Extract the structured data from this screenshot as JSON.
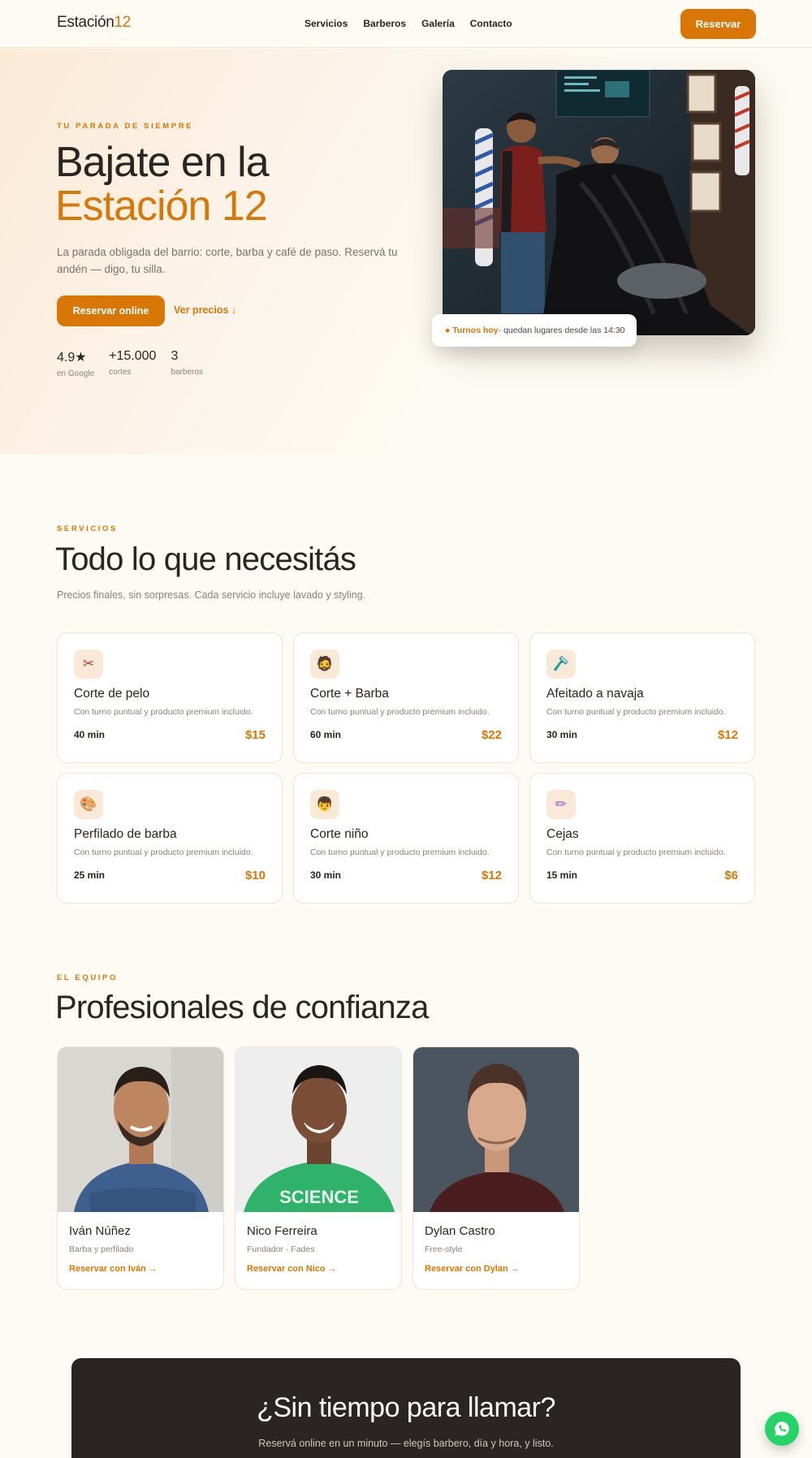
{
  "brand": {
    "name_main": "Estación",
    "name_num": "12"
  },
  "nav": {
    "links": [
      "Servicios",
      "Barberos",
      "Galería",
      "Contacto"
    ],
    "cta": "Reservar"
  },
  "hero": {
    "eyebrow": "TU PARADA DE SIEMPRE",
    "title_line1": "Bajate en la",
    "title_line2": "Estación 12",
    "description": "La parada obligada del barrio: corte, barba y café de paso. Reservá tu andén — digo, tu silla.",
    "primary_cta": "Reservar online",
    "secondary_cta": "Ver precios ↓",
    "stats": [
      {
        "value": "4.9★",
        "label": "en Google"
      },
      {
        "value": "+15.000",
        "label": "cortes"
      },
      {
        "value": "3",
        "label": "barberos"
      }
    ],
    "turnos_highlight": "● Turnos hoy",
    "turnos_text": " · quedan lugares desde las 14:30"
  },
  "services": {
    "eyebrow": "SERVICIOS",
    "title": "Todo lo que necesitás",
    "subtitle": "Precios finales, sin sorpresas. Cada servicio incluye lavado y styling.",
    "items": [
      {
        "icon": "scissors-icon",
        "glyph": "✂",
        "name": "Corte de pelo",
        "desc": "Con turno puntual y producto premium incluido.",
        "duration": "40 min",
        "price": "$15"
      },
      {
        "icon": "bearded-face-icon",
        "glyph": "🧔",
        "name": "Corte + Barba",
        "desc": "Con turno puntual y producto premium incluido.",
        "duration": "60 min",
        "price": "$22"
      },
      {
        "icon": "razor-icon",
        "glyph": "🪒",
        "name": "Afeitado a navaja",
        "desc": "Con turno puntual y producto premium incluido.",
        "duration": "30 min",
        "price": "$12"
      },
      {
        "icon": "palette-icon",
        "glyph": "🎨",
        "name": "Perfilado de barba",
        "desc": "Con turno puntual y producto premium incluido.",
        "duration": "25 min",
        "price": "$10"
      },
      {
        "icon": "child-icon",
        "glyph": "👦",
        "name": "Corte niño",
        "desc": "Con turno puntual y producto premium incluido.",
        "duration": "30 min",
        "price": "$12"
      },
      {
        "icon": "brow-pencil-icon",
        "glyph": "✏",
        "name": "Cejas",
        "desc": "Con turno puntual y producto premium incluido.",
        "duration": "15 min",
        "price": "$6"
      }
    ]
  },
  "team": {
    "eyebrow": "EL EQUIPO",
    "title": "Profesionales de confianza",
    "members": [
      {
        "name": "Iván Núñez",
        "role": "Barba y perfilado",
        "link": "Reservar con Iván →"
      },
      {
        "name": "Nico Ferreira",
        "role": "Fundador · Fades",
        "link": "Reservar con Nico →"
      },
      {
        "name": "Dylan Castro",
        "role": "Free-style",
        "link": "Reservar con Dylan →"
      }
    ]
  },
  "cta_band": {
    "title": "¿Sin tiempo para llamar?",
    "subtitle": "Reservá online en un minuto — elegís barbero, día y hora, y listo."
  },
  "colors": {
    "accent": "#d97706",
    "dark": "#2a2522",
    "background": "#fdfbf3",
    "whatsapp": "#25d366"
  }
}
